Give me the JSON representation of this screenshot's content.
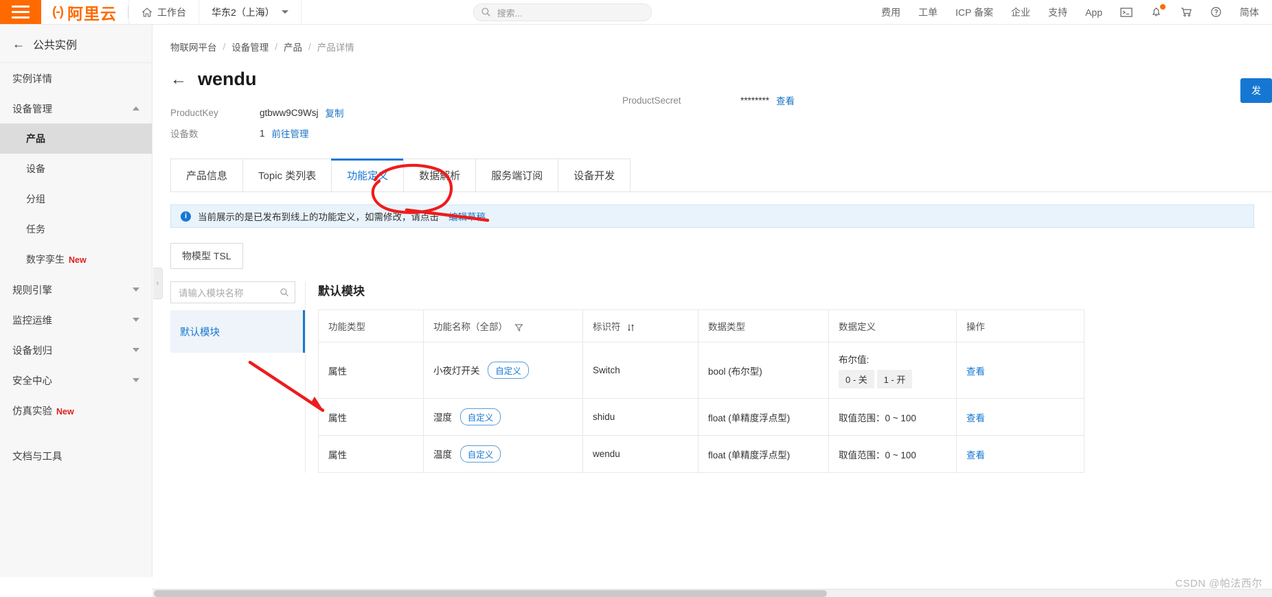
{
  "topbar": {
    "menu_icon": "hamburger-icon",
    "logo_text": "阿里云",
    "workbench": "工作台",
    "region": "华东2（上海）",
    "search_placeholder": "搜索...",
    "nav_links": [
      "费用",
      "工单",
      "ICP 备案",
      "企业",
      "支持",
      "App"
    ],
    "icons": [
      "terminal-icon",
      "bell-icon",
      "cart-icon",
      "help-icon"
    ],
    "language": "简体"
  },
  "sidebar": {
    "header": "公共实例",
    "items": [
      {
        "label": "实例详情",
        "type": "item"
      },
      {
        "label": "设备管理",
        "type": "group",
        "expanded": true
      },
      {
        "label": "产品",
        "type": "sub",
        "active": true
      },
      {
        "label": "设备",
        "type": "sub"
      },
      {
        "label": "分组",
        "type": "sub"
      },
      {
        "label": "任务",
        "type": "sub"
      },
      {
        "label": "数字孪生",
        "type": "sub",
        "tag": "New"
      },
      {
        "label": "规则引擎",
        "type": "group"
      },
      {
        "label": "监控运维",
        "type": "group"
      },
      {
        "label": "设备划归",
        "type": "group"
      },
      {
        "label": "安全中心",
        "type": "group"
      },
      {
        "label": "仿真实验",
        "type": "item",
        "tag": "New"
      },
      {
        "label": "文档与工具",
        "type": "item"
      }
    ]
  },
  "breadcrumb": [
    "物联网平台",
    "设备管理",
    "产品",
    "产品详情"
  ],
  "page": {
    "title": "wendu",
    "publish_button": "发",
    "product_key_label": "ProductKey",
    "product_key_value": "gtbww9C9Wsj",
    "copy_link": "复制",
    "product_secret_label": "ProductSecret",
    "product_secret_value": "********",
    "view_link": "查看",
    "device_count_label": "设备数",
    "device_count_value": "1",
    "manage_link": "前往管理"
  },
  "tabs": [
    {
      "label": "产品信息",
      "active": false
    },
    {
      "label": "Topic 类列表",
      "active": false
    },
    {
      "label": "功能定义",
      "active": true
    },
    {
      "label": "数据解析",
      "active": false
    },
    {
      "label": "服务端订阅",
      "active": false
    },
    {
      "label": "设备开发",
      "active": false
    }
  ],
  "banner": {
    "icon": "info-icon",
    "text": "当前展示的是已发布到线上的功能定义，如需修改，请点击",
    "link": "编辑草稿"
  },
  "tsl_button": "物模型 TSL",
  "module_panel": {
    "search_placeholder": "请输入模块名称",
    "search_icon": "search-icon",
    "items": [
      {
        "label": "默认模块",
        "active": true
      }
    ]
  },
  "table": {
    "title": "默认模块",
    "columns": [
      {
        "label": "功能类型"
      },
      {
        "label": "功能名称（全部）",
        "icon": "filter-icon"
      },
      {
        "label": "标识符",
        "icon": "sort-icon"
      },
      {
        "label": "数据类型"
      },
      {
        "label": "数据定义"
      },
      {
        "label": "操作"
      }
    ],
    "rows": [
      {
        "type": "属性",
        "name": "小夜灯开关",
        "name_tag": "自定义",
        "identifier": "Switch",
        "data_type": "bool (布尔型)",
        "definition_label": "布尔值:",
        "definition_values": [
          "0 - 关",
          "1 - 开"
        ],
        "definition_text": "",
        "action": "查看"
      },
      {
        "type": "属性",
        "name": "湿度",
        "name_tag": "自定义",
        "identifier": "shidu",
        "data_type": "float (单精度浮点型)",
        "definition_label": "",
        "definition_values": [],
        "definition_text": "取值范围：0 ~ 100",
        "action": "查看"
      },
      {
        "type": "属性",
        "name": "温度",
        "name_tag": "自定义",
        "identifier": "wendu",
        "data_type": "float (单精度浮点型)",
        "definition_label": "",
        "definition_values": [],
        "definition_text": "取值范围：0 ~ 100",
        "action": "查看"
      }
    ]
  },
  "watermark": "CSDN @帕法西尔",
  "colors": {
    "brand_orange": "#ff6a00",
    "link_blue": "#1677d2",
    "annotation_red": "#ee1c1c",
    "new_tag_red": "#e02020"
  }
}
